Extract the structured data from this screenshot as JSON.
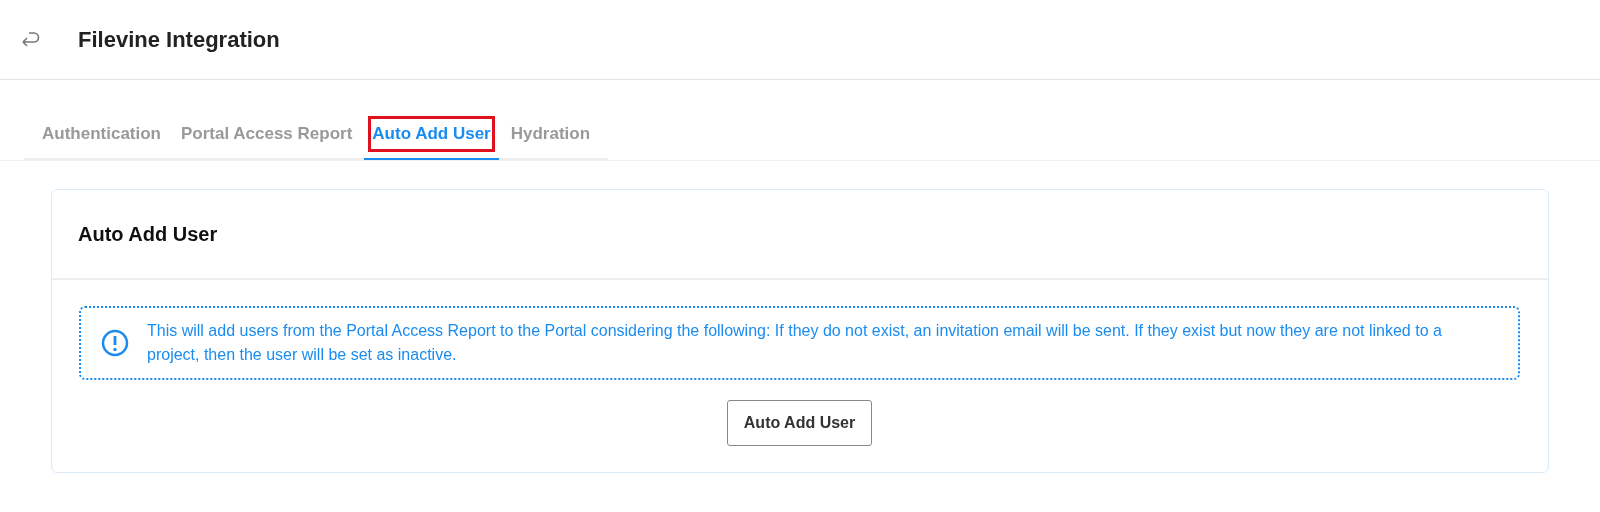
{
  "header": {
    "title": "Filevine Integration"
  },
  "tabs": [
    {
      "label": "Authentication",
      "selected": false,
      "highlighted": false
    },
    {
      "label": "Portal Access Report",
      "selected": false,
      "highlighted": false
    },
    {
      "label": "Auto Add User",
      "selected": true,
      "highlighted": true
    },
    {
      "label": "Hydration",
      "selected": false,
      "highlighted": false
    }
  ],
  "card": {
    "title": "Auto Add User",
    "alert": {
      "kind": "info",
      "message": "This will add users from the Portal Access Report to the Portal considering the following: If they do not exist, an invitation email will be sent. If they exist but now they are not linked to a project, then the user will be set as inactive."
    },
    "button": "Auto Add User"
  }
}
